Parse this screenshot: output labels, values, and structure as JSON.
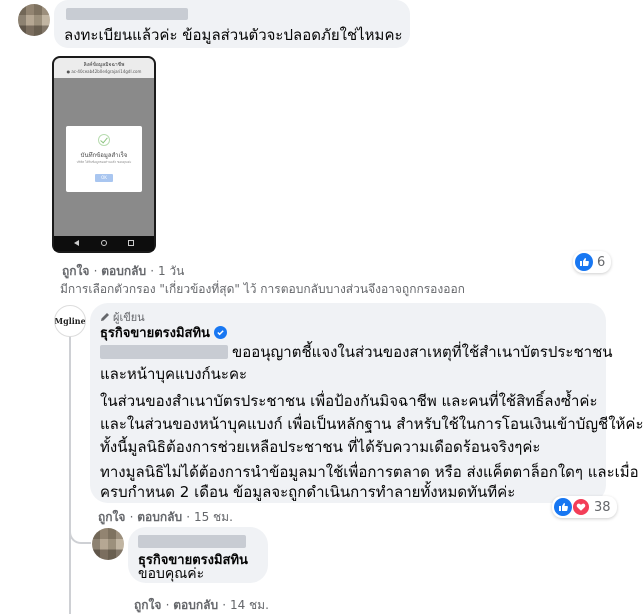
{
  "comment1": {
    "text": "ลงทะเบียนแล้วค่ะ ข้อมูลส่วนตัวจะปลอดภัยใช่ไหมคะ",
    "phone": {
      "header_title": "ลิงค์ข้อมูลมิจฉาชีพ",
      "header_url": "● ac-40ceab42b0e4grajari14gdl.com",
      "dialog_title": "บันทึกข้อมูลสำเร็จ",
      "dialog_text": "บริษัท ได้รับข้อมูลของท่านแล้ว ขอบคุณค่ะ",
      "dialog_button": "OK"
    },
    "like_label": "ถูกใจ",
    "reply_label": "ตอบกลับ",
    "time": "1 วัน",
    "reaction_count": "6"
  },
  "filter_note": "มีการเลือกตัวกรอง \"เกี่ยวข้องที่สุด\" ไว้ การตอบกลับบางส่วนจึงอาจถูกกรองออก",
  "page_reply": {
    "avatar_text": "Mgline",
    "author_badge": "ผู้เขียน",
    "author": "ธุรกิจขายตรงมิสทิน",
    "lines": [
      "ขออนุญาตชี้แจงในส่วนของสาเหตุที่ใช้สำเนาบัตรประชาชน",
      "และหน้าบุคแบงก์นะคะ",
      "ในส่วนของสำเนาบัตรประชาชน เพื่อป้องกันมิจฉาชีพ และคนที่ใช้สิทธิ์ลงซ้ำค่ะ",
      "และในส่วนของหน้าบุคแบงก์ เพื่อเป็นหลักฐาน สำหรับใช้ในการโอนเงินเข้าบัญชีให้ค่ะ",
      "ทั้งนี้มูลนิธิต้องการช่วยเหลือประชาชน ที่ได้รับความเดือดร้อนจริงๆค่ะ",
      "ทางมูลนิธิไม่ได้ต้องการนำข้อมูลมาใช้เพื่อการตลาด หรือ ส่งแค็ตตาล็อกใดๆ และเมื่อ",
      "ครบกำหนด 2 เดือน ข้อมูลจะถูกดำเนินการทำลายทั้งหมดทันทีค่ะ"
    ],
    "like_label": "ถูกใจ",
    "reply_label": "ตอบกลับ",
    "time": "15 ชม.",
    "reaction_count": "38"
  },
  "reply2": {
    "author": "ธุรกิจขายตรงมิสทิน",
    "text": "ขอบคุณค่ะ",
    "like_label": "ถูกใจ",
    "reply_label": "ตอบกลับ",
    "time": "14 ชม."
  },
  "colors": {
    "bubble": "#f0f2f5",
    "like_blue": "#1877f2",
    "heart_red": "#f33e58",
    "meta_gray": "#65676b"
  }
}
